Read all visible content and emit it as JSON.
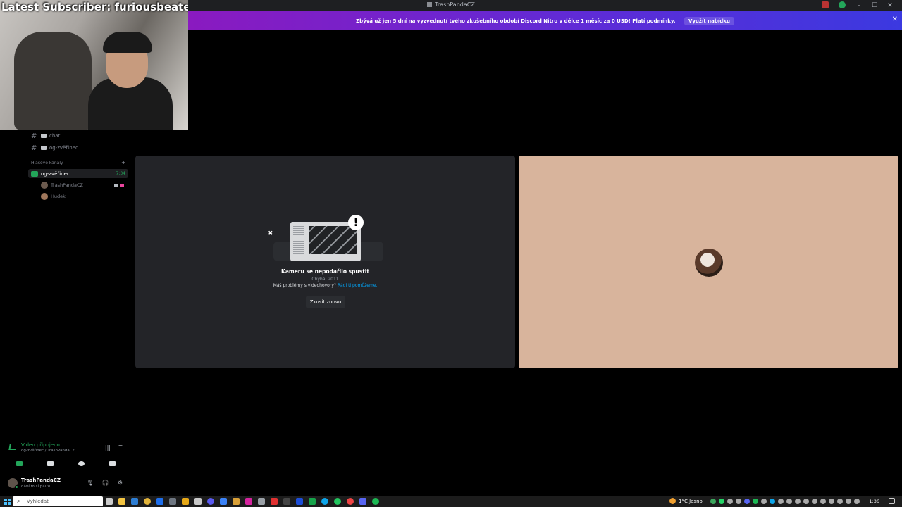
{
  "window": {
    "title": "TrashPandaCZ",
    "minimize": "–",
    "maximize": "☐",
    "close": "✕"
  },
  "overlay": {
    "subscriber_text": "Latest Subscriber: furiousbeater"
  },
  "banner": {
    "message": "Zbývá už jen 5 dní na vyzvednutí tvého zkušebního období Discord Nitro v délce 1 měsíc za 0 USD! Platí podmínky.",
    "cta": "Využít nabídku",
    "close": "✕"
  },
  "sidebar": {
    "text_channels": [
      {
        "name": "chat"
      },
      {
        "name": "og-zvěřinec"
      }
    ],
    "category": "Hlasové kanály",
    "category_plus": "+",
    "voice_channel": {
      "name": "og-zvěřinec",
      "time": "7:34"
    },
    "voice_users": [
      {
        "name": "TrashPandaCZ"
      },
      {
        "name": "Hudek"
      }
    ]
  },
  "voice_panel": {
    "status": "Video připojeno",
    "location": "og-zvěřinec / TrashPandaCZ"
  },
  "user_panel": {
    "username": "TrashPandaCZ",
    "status": "dávám si pauzu"
  },
  "camera_error": {
    "title": "Kameru se nepodařilo spustit",
    "code": "Chyba: 2011",
    "help_prefix": "Máš problémy s videohovory?",
    "help_link": "Rádi ti pomůžeme.",
    "retry": "Zkusit znovu"
  },
  "taskbar": {
    "search_placeholder": "Vyhledat",
    "weather": "1°C  Jasno",
    "time": "1:36"
  },
  "colors": {
    "online": "#23a55a",
    "link": "#00a8fc",
    "remote_tile": "#d8b49c",
    "banner_start": "#8a1ac0",
    "banner_end": "#3b39e0"
  }
}
